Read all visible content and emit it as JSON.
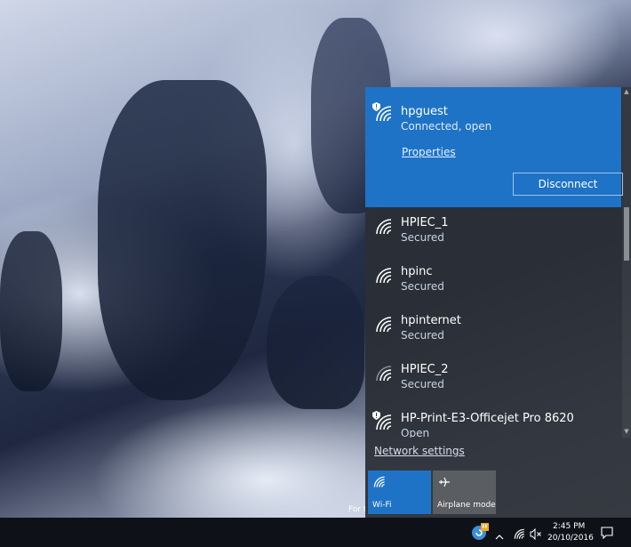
{
  "desktop": {
    "watermark_text": "For t"
  },
  "flyout": {
    "connected_network": {
      "name": "hpguest",
      "status": "Connected, open",
      "properties_label": "Properties",
      "disconnect_label": "Disconnect"
    },
    "networks": [
      {
        "name": "HPIEC_1",
        "status": "Secured"
      },
      {
        "name": "hpinc",
        "status": "Secured"
      },
      {
        "name": "hpinternet",
        "status": "Secured"
      },
      {
        "name": "HPIEC_2",
        "status": "Secured"
      },
      {
        "name": "HP-Print-E3-Officejet Pro 8620",
        "status": "Open"
      }
    ],
    "network_settings_label": "Network settings",
    "quick_actions": [
      {
        "label": "Wi-Fi",
        "icon": "wifi-icon",
        "active": true
      },
      {
        "label": "Airplane mode",
        "icon": "airplane-icon",
        "active": false
      }
    ]
  },
  "taskbar": {
    "time": "2:45 PM",
    "date": "20/10/2016",
    "icons": [
      "app-warning-icon",
      "chevron-up-icon",
      "wifi-icon",
      "volume-muted-icon",
      "notification-icon"
    ]
  },
  "colors": {
    "accent": "#1f73c6",
    "flyout_bg": "#2b2f36",
    "taskbar_bg": "#0e1218"
  }
}
